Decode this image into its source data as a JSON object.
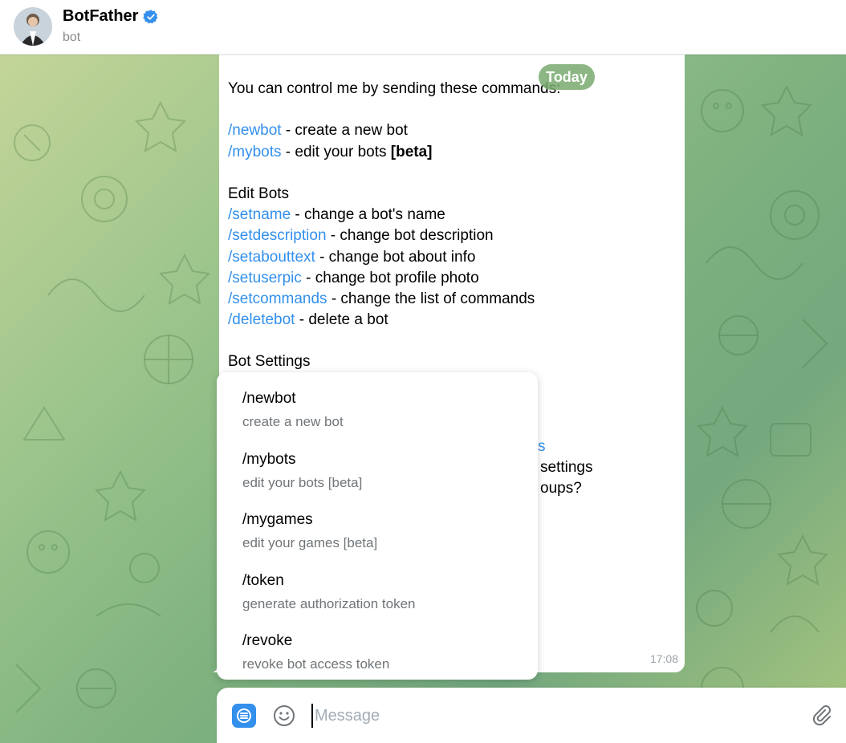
{
  "header": {
    "title": "BotFather",
    "status": "bot",
    "verified_icon": "verified-badge-icon",
    "accent": "#3390ec"
  },
  "date_chip": "Today",
  "message": {
    "intro": "You can control me by sending these commands:",
    "cmd_newbot": "/newbot",
    "desc_newbot": " - create a new bot",
    "cmd_mybots": "/mybots",
    "desc_mybots": " - edit your bots ",
    "beta": "[beta]",
    "edit_bots_heading": "Edit Bots",
    "cmd_setname": "/setname",
    "desc_setname": " - change a bot's name",
    "cmd_setdescription": "/setdescription",
    "desc_setdescription": " - change bot description",
    "cmd_setabouttext": "/setabouttext",
    "desc_setabouttext": " - change bot about info",
    "cmd_setuserpic": "/setuserpic",
    "desc_setuserpic": " - change bot profile photo",
    "cmd_setcommands": "/setcommands",
    "desc_setcommands": " - change the list of commands",
    "cmd_deletebot": "/deletebot",
    "desc_deletebot": " - delete a bot",
    "bot_settings_heading": "Bot Settings",
    "peek_1": "s",
    "peek_2": "settings",
    "peek_3": "oups?",
    "time": "17:08"
  },
  "command_popup": [
    {
      "command": "/newbot",
      "description": "create a new bot"
    },
    {
      "command": "/mybots",
      "description": "edit your bots [beta]"
    },
    {
      "command": "/mygames",
      "description": "edit your games [beta]"
    },
    {
      "command": "/token",
      "description": "generate authorization token"
    },
    {
      "command": "/revoke",
      "description": "revoke bot access token"
    }
  ],
  "composer": {
    "placeholder": "Message",
    "menu_icon": "bot-menu-icon",
    "emoji_icon": "emoji-icon",
    "attach_icon": "paperclip-icon"
  }
}
